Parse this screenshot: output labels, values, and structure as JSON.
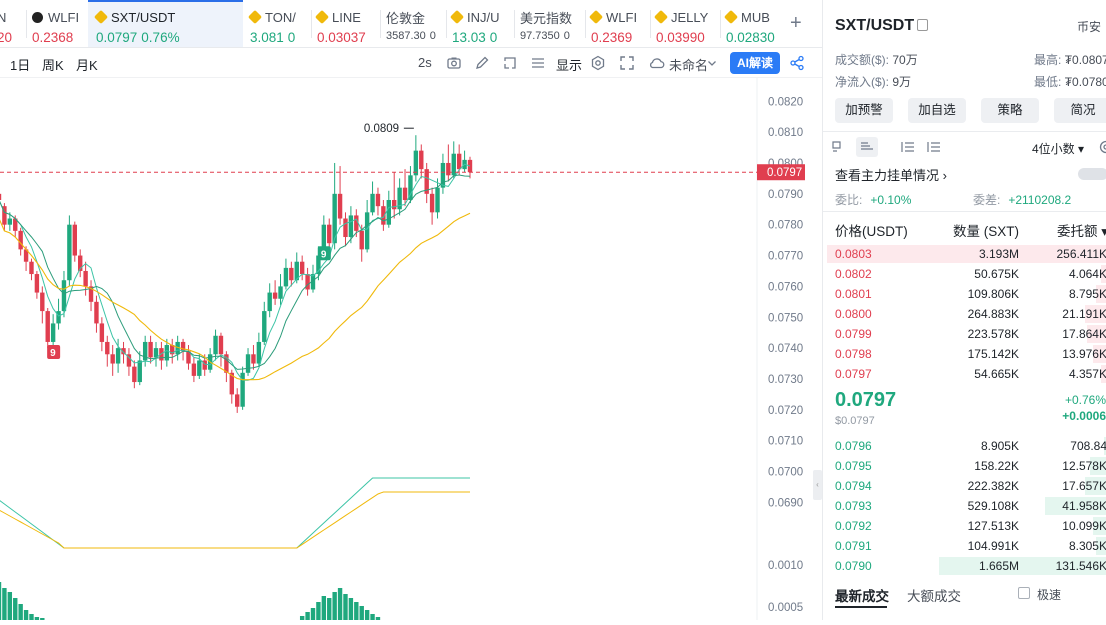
{
  "tabs": [
    {
      "symbol": "N",
      "price": "20",
      "change": "",
      "icon": "none",
      "active": false
    },
    {
      "symbol": "WLFI",
      "price": "0.2368",
      "change": "",
      "icon": "x-coin-icon",
      "active": false
    },
    {
      "symbol": "SXT/USDT",
      "price": "0.0797",
      "change": "0.76%",
      "icon": "diamond-icon",
      "active": true
    },
    {
      "symbol": "TON/",
      "price": "3.081",
      "change": "0",
      "icon": "diamond-icon",
      "active": false
    },
    {
      "symbol": "LINE",
      "price": "0.03037",
      "change": "",
      "icon": "diamond-icon",
      "active": false
    },
    {
      "symbol": "伦敦金",
      "price": "3587.30",
      "change": "0",
      "icon": "none",
      "active": false,
      "small": true
    },
    {
      "symbol": "INJ/U",
      "price": "13.03",
      "change": "0",
      "icon": "diamond-icon",
      "active": false
    },
    {
      "symbol": "美元指数",
      "price": "97.7350",
      "change": "0",
      "icon": "none",
      "active": false,
      "small": true
    },
    {
      "symbol": "WLFI",
      "price": "0.2369",
      "change": "",
      "icon": "diamond-icon",
      "active": false
    },
    {
      "symbol": "JELLY",
      "price": "0.03990",
      "change": "",
      "icon": "diamond-icon",
      "active": false
    },
    {
      "symbol": "MUB",
      "price": "0.02830",
      "change": "",
      "icon": "diamond-icon",
      "active": false
    }
  ],
  "toolbar": {
    "intervals": [
      "1日",
      "周K",
      "月K"
    ],
    "refresh": "2s",
    "display": "显示",
    "layout_name": "未命名",
    "ai_button": "AI解读"
  },
  "chart": {
    "y_labels": [
      "0.0820",
      "0.0810",
      "0.0800",
      "0.0790",
      "0.0780",
      "0.0770",
      "0.0760",
      "0.0750",
      "0.0740",
      "0.0730",
      "0.0720",
      "0.0710",
      "0.0700",
      "0.0690"
    ],
    "current_price_tag": "0.0797",
    "high_marker": "0.0809",
    "markers": [
      "9",
      "9"
    ],
    "sub_y_labels": [
      "0.0010",
      "0.0005"
    ]
  },
  "chart_data": {
    "type": "candlestick",
    "ylim": [
      0.0683,
      0.0823
    ],
    "candles": [
      [
        0.079,
        0.0788,
        0.0792,
        0.0786
      ],
      [
        0.0786,
        0.078,
        0.0787,
        0.0778
      ],
      [
        0.078,
        0.0782,
        0.0784,
        0.0778
      ],
      [
        0.0782,
        0.0778,
        0.0783,
        0.0776
      ],
      [
        0.0778,
        0.0772,
        0.0779,
        0.077
      ],
      [
        0.0772,
        0.0768,
        0.0773,
        0.0765
      ],
      [
        0.0768,
        0.0764,
        0.0769,
        0.0762
      ],
      [
        0.0764,
        0.0758,
        0.0765,
        0.0756
      ],
      [
        0.0758,
        0.0752,
        0.076,
        0.0748
      ],
      [
        0.0752,
        0.0742,
        0.0753,
        0.074
      ],
      [
        0.0742,
        0.0748,
        0.0751,
        0.0741
      ],
      [
        0.0748,
        0.0752,
        0.0756,
        0.0746
      ],
      [
        0.0752,
        0.0762,
        0.0765,
        0.075
      ],
      [
        0.0762,
        0.078,
        0.0783,
        0.076
      ],
      [
        0.078,
        0.077,
        0.0781,
        0.0768
      ],
      [
        0.077,
        0.0765,
        0.0772,
        0.0763
      ],
      [
        0.0765,
        0.076,
        0.0768,
        0.0757
      ],
      [
        0.076,
        0.0755,
        0.0762,
        0.0752
      ],
      [
        0.0755,
        0.0748,
        0.0757,
        0.0745
      ],
      [
        0.0748,
        0.0742,
        0.075,
        0.0739
      ],
      [
        0.0742,
        0.0738,
        0.0744,
        0.0734
      ],
      [
        0.0738,
        0.0735,
        0.0741,
        0.0731
      ],
      [
        0.0735,
        0.074,
        0.0743,
        0.0732
      ],
      [
        0.074,
        0.0738,
        0.0742,
        0.0735
      ],
      [
        0.0738,
        0.0734,
        0.074,
        0.0731
      ],
      [
        0.0734,
        0.0729,
        0.0736,
        0.0727
      ],
      [
        0.0729,
        0.0736,
        0.0739,
        0.0728
      ],
      [
        0.0736,
        0.0742,
        0.0744,
        0.0734
      ],
      [
        0.0742,
        0.0737,
        0.0744,
        0.0735
      ],
      [
        0.0737,
        0.074,
        0.0742,
        0.0734
      ],
      [
        0.074,
        0.0736,
        0.0742,
        0.0733
      ],
      [
        0.0736,
        0.0741,
        0.0743,
        0.0734
      ],
      [
        0.0741,
        0.0738,
        0.0743,
        0.0735
      ],
      [
        0.0738,
        0.0742,
        0.0744,
        0.0736
      ],
      [
        0.0742,
        0.0739,
        0.0743,
        0.0736
      ],
      [
        0.0739,
        0.0735,
        0.0741,
        0.0733
      ],
      [
        0.0735,
        0.0731,
        0.0737,
        0.0729
      ],
      [
        0.0731,
        0.0736,
        0.0738,
        0.073
      ],
      [
        0.0736,
        0.0733,
        0.0738,
        0.0731
      ],
      [
        0.0733,
        0.0738,
        0.074,
        0.0732
      ],
      [
        0.0738,
        0.0744,
        0.0746,
        0.0736
      ],
      [
        0.0744,
        0.0738,
        0.0745,
        0.0734
      ],
      [
        0.0738,
        0.0732,
        0.0739,
        0.0729
      ],
      [
        0.0732,
        0.0725,
        0.0733,
        0.0722
      ],
      [
        0.0725,
        0.0721,
        0.0727,
        0.0719
      ],
      [
        0.0721,
        0.0732,
        0.0734,
        0.072
      ],
      [
        0.0732,
        0.0738,
        0.074,
        0.0731
      ],
      [
        0.0738,
        0.0735,
        0.0741,
        0.0733
      ],
      [
        0.0735,
        0.0742,
        0.0745,
        0.0734
      ],
      [
        0.0742,
        0.0752,
        0.0755,
        0.0741
      ],
      [
        0.0752,
        0.0758,
        0.0761,
        0.075
      ],
      [
        0.0758,
        0.0756,
        0.0762,
        0.0754
      ],
      [
        0.0756,
        0.076,
        0.0764,
        0.0754
      ],
      [
        0.076,
        0.0766,
        0.0769,
        0.0759
      ],
      [
        0.0766,
        0.0762,
        0.0768,
        0.076
      ],
      [
        0.0762,
        0.0768,
        0.0771,
        0.0761
      ],
      [
        0.0768,
        0.0764,
        0.077,
        0.0762
      ],
      [
        0.0764,
        0.0759,
        0.0766,
        0.0757
      ],
      [
        0.0759,
        0.0764,
        0.0767,
        0.0758
      ],
      [
        0.0764,
        0.077,
        0.0773,
        0.0762
      ],
      [
        0.077,
        0.078,
        0.0783,
        0.0769
      ],
      [
        0.078,
        0.0774,
        0.0782,
        0.0771
      ],
      [
        0.0774,
        0.079,
        0.08,
        0.0772
      ],
      [
        0.079,
        0.0782,
        0.0799,
        0.078
      ],
      [
        0.0782,
        0.0776,
        0.0784,
        0.0773
      ],
      [
        0.0776,
        0.0783,
        0.0786,
        0.0774
      ],
      [
        0.0783,
        0.0778,
        0.0785,
        0.0776
      ],
      [
        0.0778,
        0.0772,
        0.078,
        0.0768
      ],
      [
        0.0772,
        0.0784,
        0.0788,
        0.0771
      ],
      [
        0.0784,
        0.079,
        0.0794,
        0.0783
      ],
      [
        0.079,
        0.0786,
        0.0792,
        0.0783
      ],
      [
        0.0786,
        0.078,
        0.0788,
        0.0778
      ],
      [
        0.078,
        0.0788,
        0.0791,
        0.0779
      ],
      [
        0.0788,
        0.0785,
        0.0797,
        0.0782
      ],
      [
        0.0785,
        0.0792,
        0.0795,
        0.0783
      ],
      [
        0.0792,
        0.0788,
        0.0798,
        0.0786
      ],
      [
        0.0788,
        0.0796,
        0.0799,
        0.0787
      ],
      [
        0.0796,
        0.0804,
        0.0809,
        0.0794
      ],
      [
        0.0804,
        0.0798,
        0.0806,
        0.0795
      ],
      [
        0.0798,
        0.079,
        0.08,
        0.0787
      ],
      [
        0.079,
        0.0784,
        0.0792,
        0.078
      ],
      [
        0.0784,
        0.0792,
        0.0795,
        0.0782
      ],
      [
        0.0792,
        0.08,
        0.0803,
        0.079
      ],
      [
        0.08,
        0.0796,
        0.0806,
        0.0794
      ],
      [
        0.0796,
        0.0803,
        0.0807,
        0.0795
      ],
      [
        0.0803,
        0.0798,
        0.0806,
        0.0796
      ],
      [
        0.0798,
        0.0801,
        0.0804,
        0.0797
      ],
      [
        0.0801,
        0.0797,
        0.0802,
        0.0795
      ]
    ]
  },
  "panel": {
    "title": "SXT/USDT",
    "exchange": "币安",
    "volume_label": "成交额($):",
    "volume_value": "70万",
    "netflow_label": "净流入($):",
    "netflow_value": "9万",
    "high_label": "最高:",
    "high_value": "₮0.0807",
    "low_label": "最低:",
    "low_value": "₮0.0780",
    "buttons": [
      "加预警",
      "加自选",
      "策略",
      "简况"
    ],
    "decimals": "4位小数",
    "watch_link": "查看主力挂单情况",
    "bid_ratio_label": "委比:",
    "bid_ratio_value": "+0.10%",
    "bid_diff_label": "委差:",
    "bid_diff_value": "+2110208.2",
    "col_price": "价格(USDT)",
    "col_qty": "数量 (SXT)",
    "col_total": "委托额",
    "asks": [
      {
        "price": "0.0803",
        "qty": "3.193M",
        "total": "256.411K",
        "depth": 1.0
      },
      {
        "price": "0.0802",
        "qty": "50.675K",
        "total": "4.064K",
        "depth": 0.02
      },
      {
        "price": "0.0801",
        "qty": "109.806K",
        "total": "8.795K",
        "depth": 0.04
      },
      {
        "price": "0.0800",
        "qty": "264.883K",
        "total": "21.191K",
        "depth": 0.08
      },
      {
        "price": "0.0799",
        "qty": "223.578K",
        "total": "17.864K",
        "depth": 0.07
      },
      {
        "price": "0.0798",
        "qty": "175.142K",
        "total": "13.976K",
        "depth": 0.05
      },
      {
        "price": "0.0797",
        "qty": "54.665K",
        "total": "4.357K",
        "depth": 0.02
      }
    ],
    "mid_price": "0.0797",
    "mid_sub": "$0.0797",
    "mid_pct": "+0.76%",
    "mid_abs": "+0.0006",
    "bids": [
      {
        "price": "0.0796",
        "qty": "8.905K",
        "total": "708.84",
        "depth": 0.01
      },
      {
        "price": "0.0795",
        "qty": "158.22K",
        "total": "12.578K",
        "depth": 0.06
      },
      {
        "price": "0.0794",
        "qty": "222.382K",
        "total": "17.657K",
        "depth": 0.08
      },
      {
        "price": "0.0793",
        "qty": "529.108K",
        "total": "41.958K",
        "depth": 0.22
      },
      {
        "price": "0.0792",
        "qty": "127.513K",
        "total": "10.099K",
        "depth": 0.05
      },
      {
        "price": "0.0791",
        "qty": "104.991K",
        "total": "8.305K",
        "depth": 0.04
      },
      {
        "price": "0.0790",
        "qty": "1.665M",
        "total": "131.546K",
        "depth": 0.6
      }
    ],
    "bottom_tabs": [
      "最新成交",
      "大额成交"
    ],
    "checkbox_label": "极速"
  }
}
